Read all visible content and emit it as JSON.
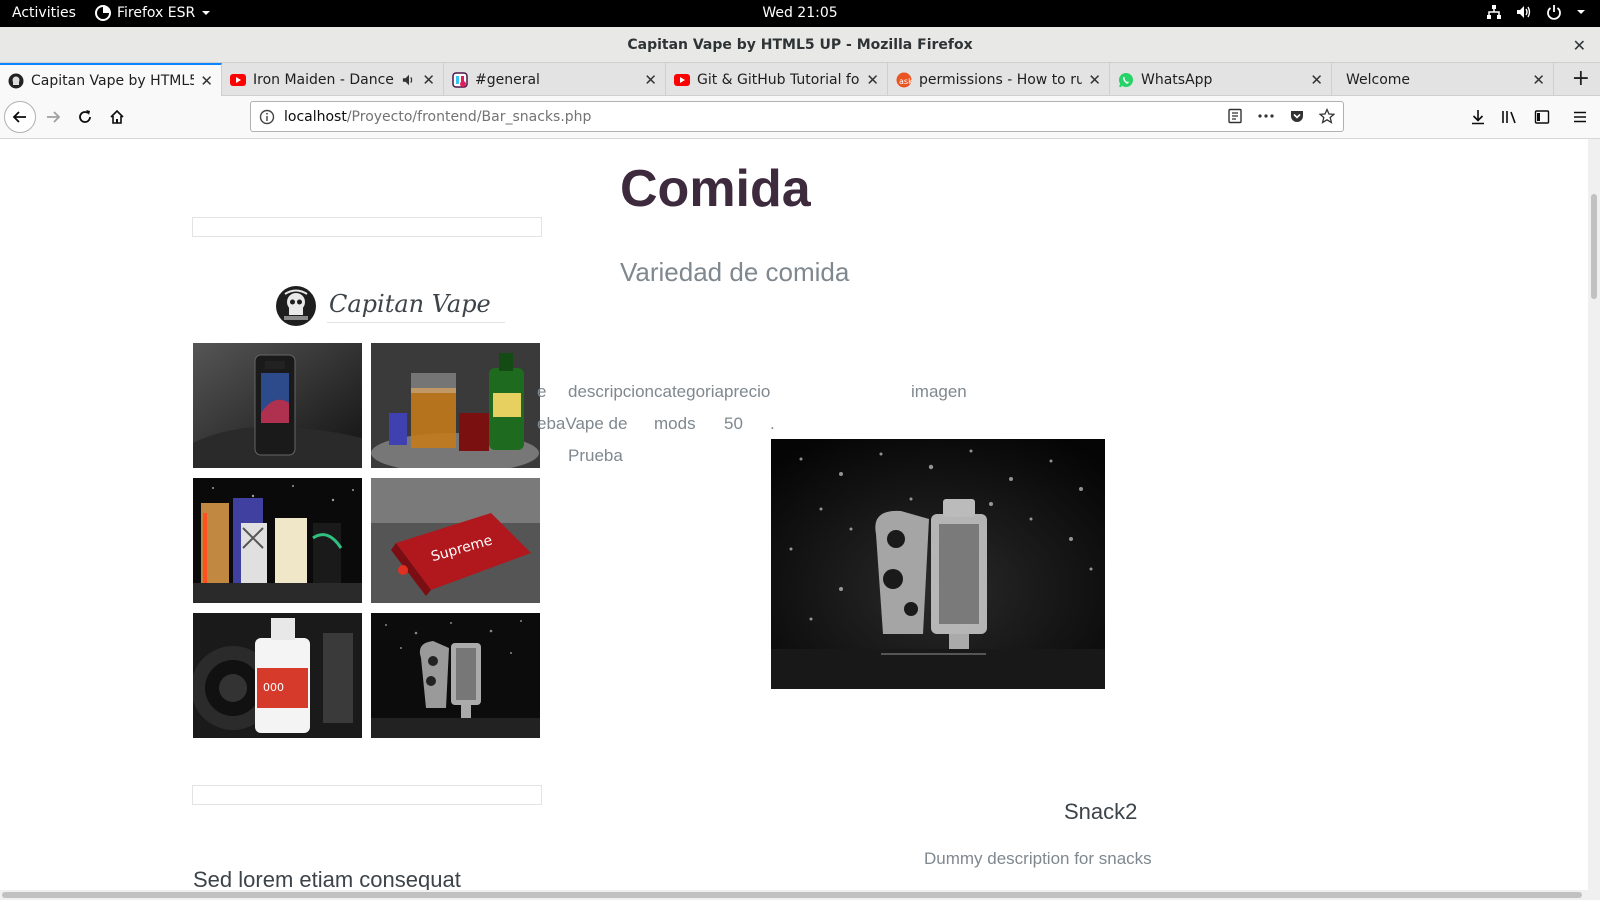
{
  "topbar": {
    "activities": "Activities",
    "app_name": "Firefox ESR",
    "clock": "Wed 21:05"
  },
  "window": {
    "title": "Capitan Vape by HTML5 UP - Mozilla Firefox"
  },
  "tabs": [
    {
      "label": "Capitan Vape by HTML5 UP",
      "favicon": "capitan-vape-logo-icon",
      "active": true
    },
    {
      "label": "Iron Maiden - Dance Of Death",
      "favicon": "youtube-icon",
      "active": false,
      "playing_audio": true
    },
    {
      "label": "#general",
      "favicon": "slack-icon",
      "active": false
    },
    {
      "label": "Git & GitHub Tutorial for Beginners",
      "favicon": "youtube-icon",
      "active": false
    },
    {
      "label": "permissions - How to run",
      "favicon": "askubuntu-icon",
      "active": false
    },
    {
      "label": "WhatsApp",
      "favicon": "whatsapp-icon",
      "active": false
    },
    {
      "label": "Welcome",
      "favicon": "none",
      "active": false
    }
  ],
  "navbar": {
    "url_host": "localhost",
    "url_path": "/Proyecto/frontend/Bar_snacks.php"
  },
  "page": {
    "heading": "Comida",
    "subheading": "Variedad de comida",
    "brand": "Capitan Vape",
    "table": {
      "headers": [
        "e",
        "descripcion",
        "categoria",
        "precio",
        "imagen"
      ],
      "row": {
        "nombre": "ebaVape de",
        "descripcion_line1": "",
        "descripcion_line2": "Prueba",
        "categoria": "mods",
        "precio": "50",
        "dot": "."
      }
    },
    "snack_name": "Snack2",
    "snack_description": "Dummy description for snacks",
    "sidebar_title": "Sed lorem etiam consequat"
  },
  "colors": {
    "heading": "#3d2b3d",
    "text": "#7f888f",
    "tab_accent": "#0a84ff"
  }
}
